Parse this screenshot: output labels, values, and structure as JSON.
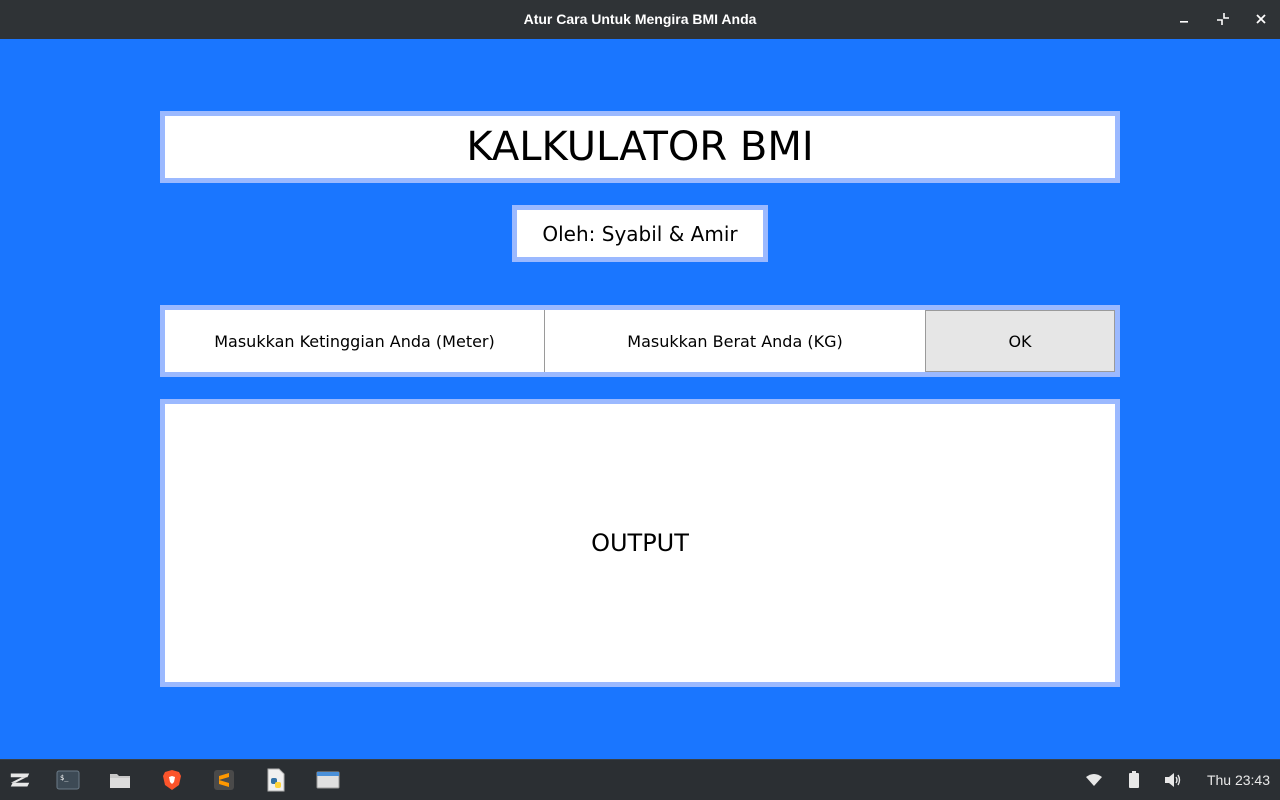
{
  "window": {
    "title": "Atur Cara Untuk Mengira BMI Anda",
    "controls": [
      "minimize-icon",
      "restore-icon",
      "close-icon"
    ]
  },
  "app": {
    "heading": "KALKULATOR BMI",
    "author": "Oleh: Syabil & Amir",
    "height_label": "Masukkan Ketinggian Anda (Meter)",
    "weight_label": "Masukkan Berat Anda (KG)",
    "ok_label": "OK",
    "output_label": "OUTPUT"
  },
  "taskbar": {
    "apps": [
      "zorin-menu-icon",
      "terminal-icon",
      "files-icon",
      "brave-browser-icon",
      "sublime-text-icon",
      "python-file-icon",
      "window-icon"
    ],
    "tray": [
      "wifi-icon",
      "battery-icon",
      "volume-icon"
    ],
    "clock": "Thu 23:43"
  },
  "colors": {
    "background": "#1a76ff",
    "panel_border": "#9bb9ff",
    "titlebar": "#2f3336",
    "taskbar": "#2b2f33"
  }
}
